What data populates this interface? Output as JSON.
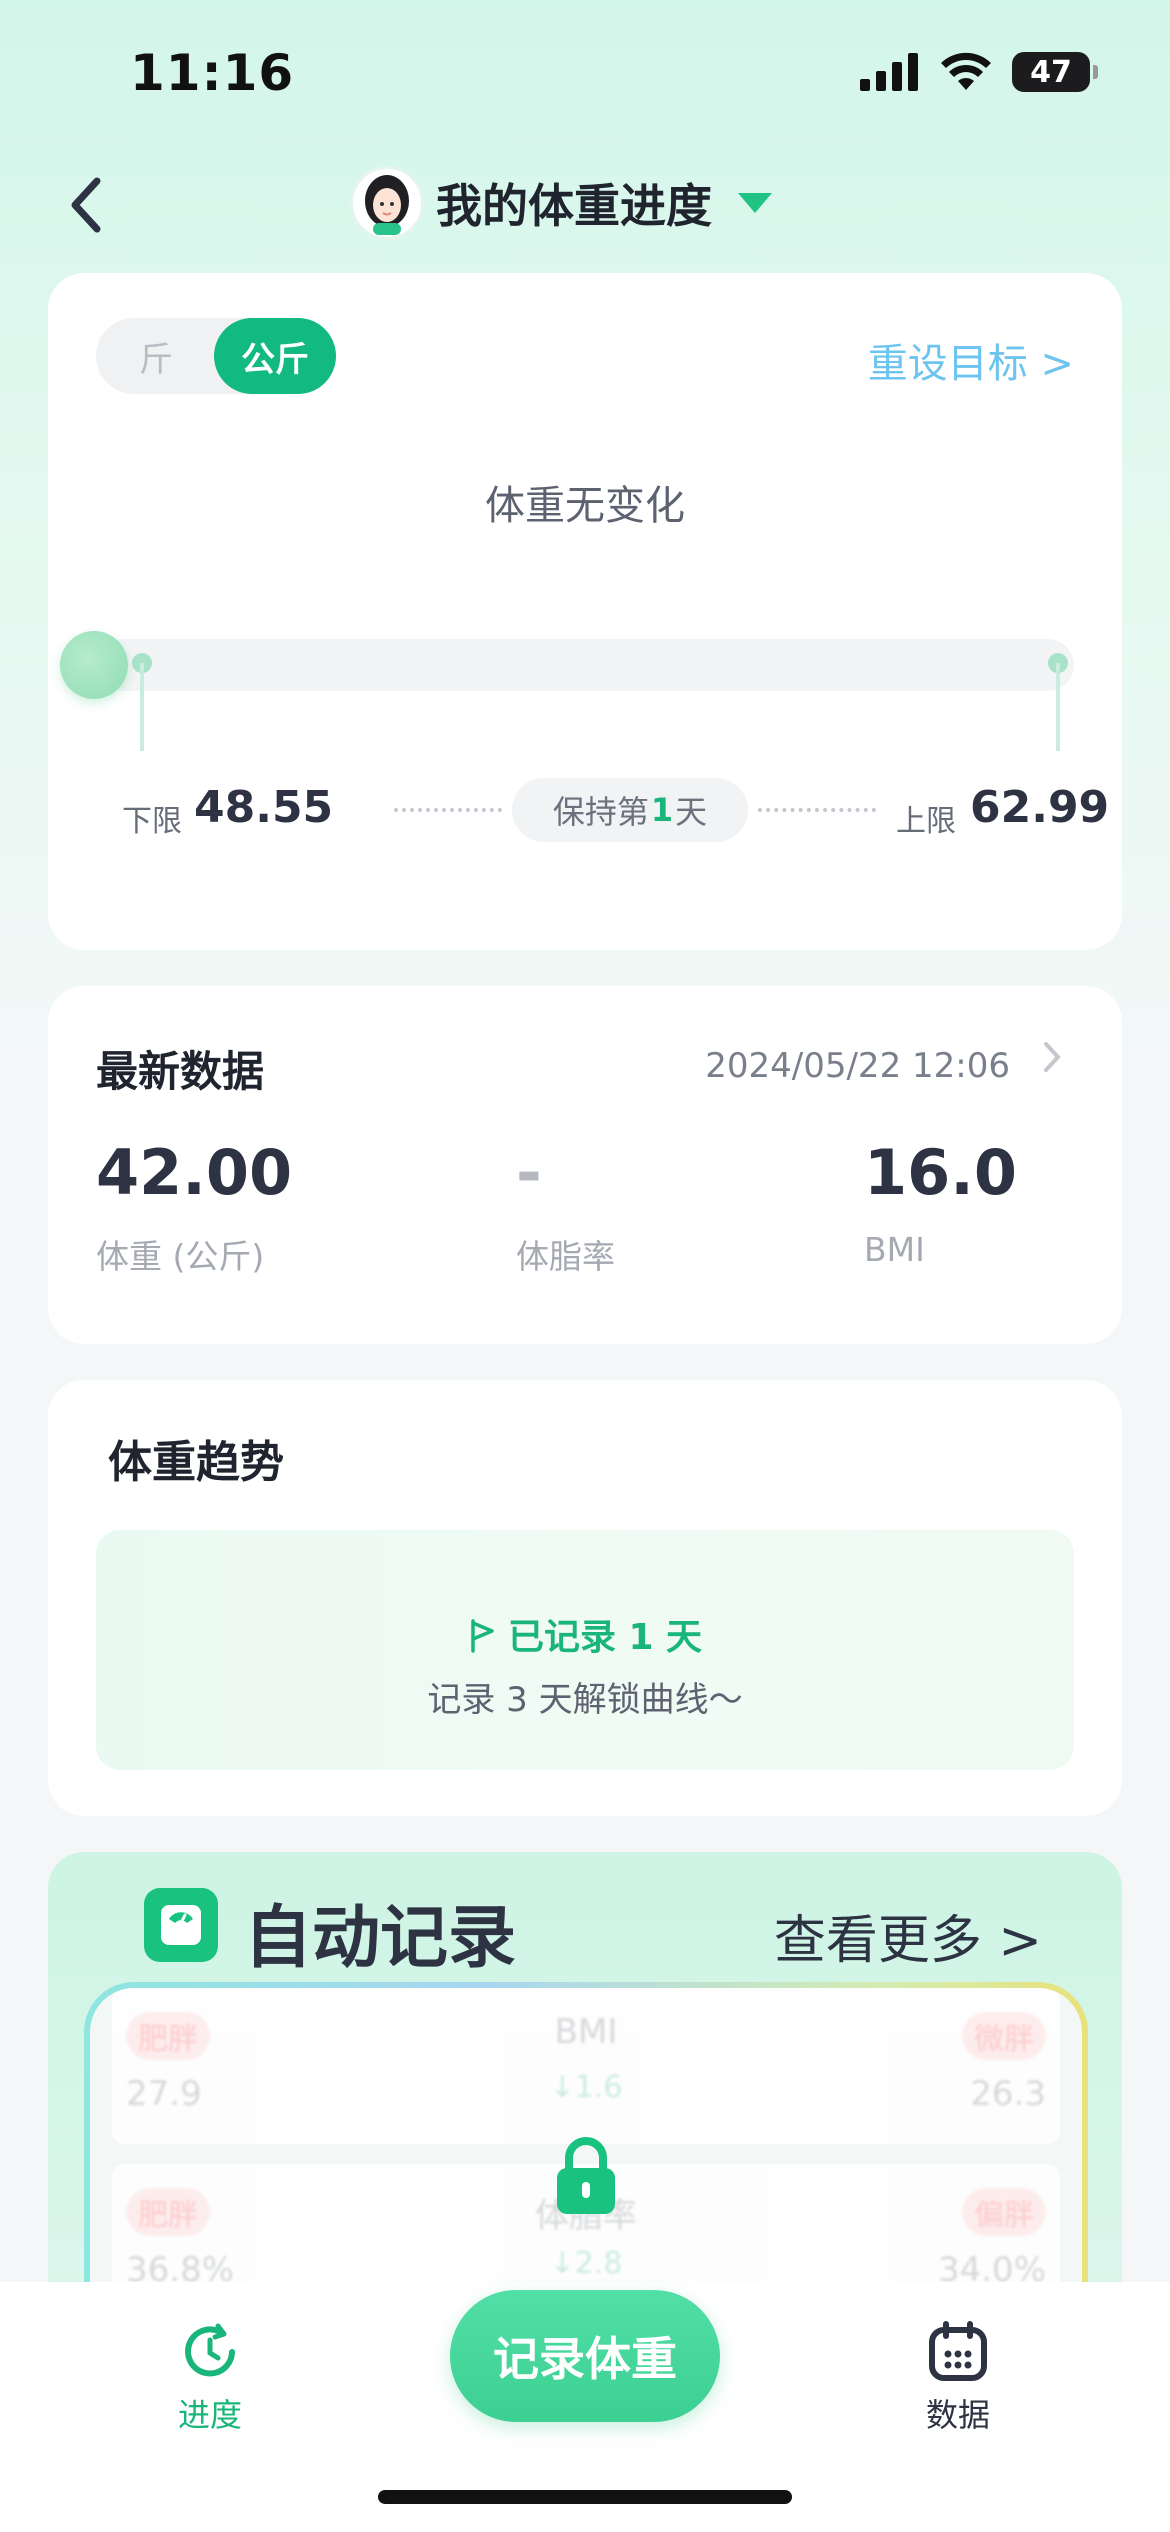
{
  "status_bar": {
    "time": "11:16",
    "battery": "47"
  },
  "nav": {
    "title": "我的体重进度"
  },
  "goal_card": {
    "unit_jin": "斤",
    "unit_gongjin": "公斤",
    "reset_goal": "重设目标 >",
    "status": "体重无变化",
    "lower_label": "下限",
    "lower_value": "48.55",
    "keep_prefix": "保持第",
    "keep_days": "1",
    "keep_suffix": "天",
    "upper_label": "上限",
    "upper_value": "62.99"
  },
  "latest": {
    "title": "最新数据",
    "timestamp": "2024/05/22 12:06",
    "weight_value": "42.00",
    "weight_label": "体重 (公斤)",
    "bodyfat_value": "-",
    "bodyfat_label": "体脂率",
    "bmi_value": "16.0",
    "bmi_label": "BMI"
  },
  "trend": {
    "title": "体重趋势",
    "recorded": "已记录 1 天",
    "unlock_hint": "记录 3 天解锁曲线～"
  },
  "auto_record": {
    "title": "自动记录",
    "more": "查看更多 >",
    "rows": [
      {
        "left_tag": "肥胖",
        "left_value": "27.9",
        "center_label": "BMI",
        "center_change": "↓1.6",
        "right_tag": "微胖",
        "right_value": "26.3"
      },
      {
        "left_tag": "肥胖",
        "left_value": "36.8%",
        "center_label": "体脂率",
        "center_change": "↓2.8",
        "right_tag": "偏胖",
        "right_value": "34.0%"
      }
    ]
  },
  "tabbar": {
    "progress_label": "进度",
    "record_button": "记录体重",
    "data_label": "数据"
  },
  "colors": {
    "accent": "#12b981",
    "link": "#6cc4ef",
    "warning_tag": "#ff7a7a"
  }
}
